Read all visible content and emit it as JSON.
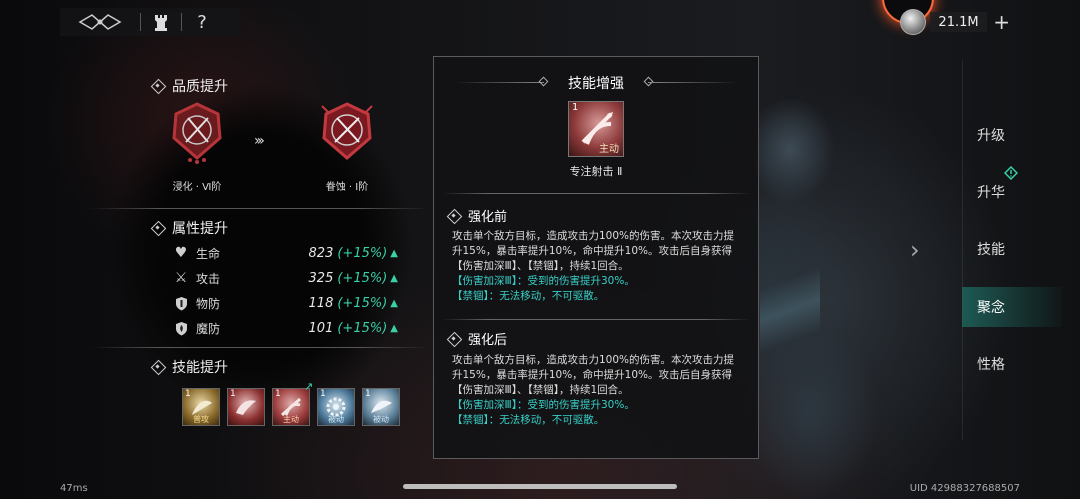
{
  "topbar": {
    "tower_icon": "tower-icon",
    "help_label": "?"
  },
  "currency": {
    "amount": "21.1M",
    "add_label": "+"
  },
  "quality": {
    "heading": "品质提升",
    "from_label": "浸化 · Ⅵ阶",
    "to_label": "眷蚀 · Ⅰ阶"
  },
  "attributes": {
    "heading": "属性提升",
    "stats": [
      {
        "icon": "heart-icon",
        "name": "生命",
        "value": "823",
        "increase": "(+15%)"
      },
      {
        "icon": "swords-icon",
        "name": "攻击",
        "value": "325",
        "increase": "(+15%)"
      },
      {
        "icon": "shield-icon",
        "name": "物防",
        "value": "118",
        "increase": "(+15%)"
      },
      {
        "icon": "flame-shield-icon",
        "name": "魔防",
        "value": "101",
        "increase": "(+15%)"
      }
    ]
  },
  "skills": {
    "heading": "技能提升",
    "items": [
      {
        "level": "1",
        "tag": "普攻",
        "color": "#b8923a"
      },
      {
        "level": "1",
        "tag": "",
        "color": "#9a3a3a"
      },
      {
        "level": "1",
        "tag": "主动",
        "color": "#a34040"
      },
      {
        "level": "1",
        "tag": "被动",
        "color": "#4d7a9a"
      },
      {
        "level": "1",
        "tag": "被动",
        "color": "#5a7f98"
      }
    ]
  },
  "right_nav": {
    "items": [
      "升级",
      "升华",
      "技能",
      "聚念",
      "性格"
    ],
    "active": "聚念"
  },
  "panel": {
    "title": "技能增强",
    "skill": {
      "level": "1",
      "tag": "主动",
      "name": "专注射击 Ⅱ"
    },
    "before": {
      "heading": "强化前",
      "text": "攻击单个敌方目标，造成攻击力100%的伤害。本次攻击力提升15%，暴击率提升10%，命中提升10%。攻击后自身获得【伤害加深Ⅲ】、【禁锢】，持续1回合。",
      "note1": "【伤害加深Ⅲ】：受到的伤害提升30%。",
      "note2": "【禁锢】：无法移动，不可驱散。"
    },
    "after": {
      "heading": "强化后",
      "text": "攻击单个敌方目标，造成攻击力100%的伤害。本次攻击力提升15%，暴击率提升10%，命中提升10%。攻击后自身获得【伤害加深Ⅲ】、【禁锢】，持续1回合。",
      "note1": "【伤害加深Ⅲ】：受到的伤害提升30%。",
      "note2": "【禁锢】：无法移动，不可驱散。"
    }
  },
  "footer": {
    "latency": "47ms",
    "uid": "UID 42988327688507"
  },
  "colors": {
    "accent": "#39d0a8",
    "highlight": "#39d0c8",
    "emblem_red": "#b5353a"
  }
}
